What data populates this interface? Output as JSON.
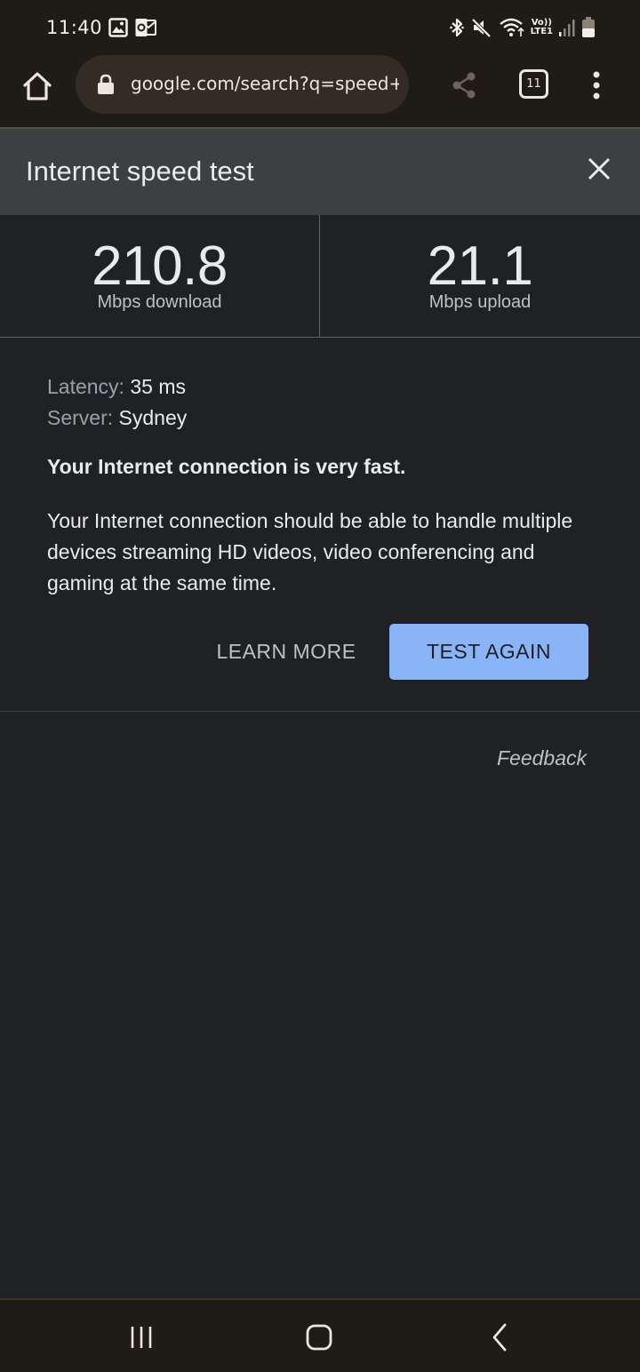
{
  "status_bar": {
    "time": "11:40",
    "left_icons": [
      "image-icon",
      "outlook-icon"
    ],
    "right_icons": [
      "bluetooth-icon",
      "mute-icon",
      "wifi-icon",
      "volte-lte-icon",
      "signal-icon",
      "battery-icon"
    ],
    "volte_label": "Vo))",
    "lte_label": "LTE1"
  },
  "toolbar": {
    "url": "google.com/search?q=speed+te",
    "tab_count": "11"
  },
  "speed_test": {
    "title": "Internet speed test",
    "download_value": "210.8",
    "download_unit": "Mbps download",
    "upload_value": "21.1",
    "upload_unit": "Mbps upload",
    "latency_label": "Latency:",
    "latency_value": "35 ms",
    "server_label": "Server:",
    "server_value": "Sydney",
    "verdict": "Your Internet connection is very fast.",
    "description": "Your Internet connection should be able to handle multiple devices streaming HD videos, video conferencing and gaming at the same time.",
    "learn_more_label": "LEARN MORE",
    "test_again_label": "TEST AGAIN",
    "feedback_label": "Feedback"
  },
  "colors": {
    "accent": "#8ab4f8",
    "background": "#202124",
    "header": "#3c4043",
    "chrome": "#1f1b16"
  }
}
